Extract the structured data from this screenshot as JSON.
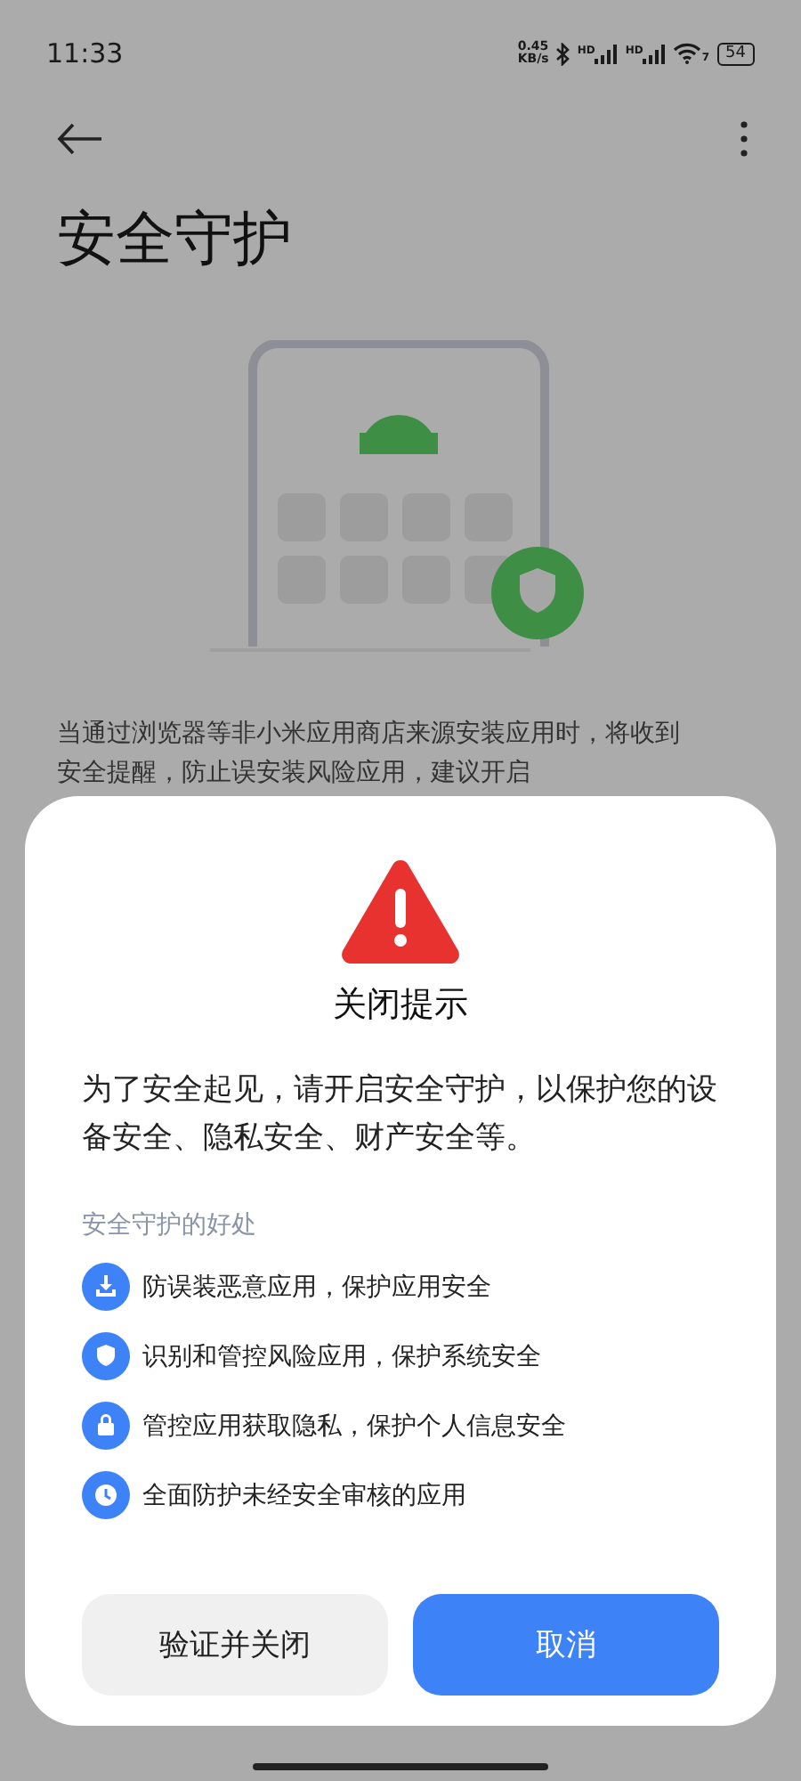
{
  "status_bar": {
    "time": "11:33",
    "speed_value": "0.45",
    "speed_unit": "KB/s",
    "signals": [
      {
        "label": "HD"
      },
      {
        "label": "HD"
      }
    ],
    "wifi_label": "7",
    "battery": "54"
  },
  "page": {
    "title": "安全守护",
    "description_lines": [
      "当通过浏览器等非小米应用商店来源安装应用时，将收到",
      "安全提醒，防止误安装风险应用，建议开启"
    ]
  },
  "dialog": {
    "title": "关闭提示",
    "message": "为了安全起见，请开启安全守护，以保护您的设备安全、隐私安全、财产安全等。",
    "benefits_heading": "安全守护的好处",
    "benefits": [
      {
        "kind": "download",
        "text": "防误装恶意应用，保护应用安全"
      },
      {
        "kind": "shield",
        "text": "识别和管控风险应用，保护系统安全"
      },
      {
        "kind": "lock",
        "text": "管控应用获取隐私，保护个人信息安全"
      },
      {
        "kind": "clock",
        "text": "全面防护未经安全审核的应用"
      }
    ],
    "buttons": [
      {
        "label": "验证并关闭",
        "primary": false
      },
      {
        "label": "取消",
        "primary": true
      }
    ]
  }
}
